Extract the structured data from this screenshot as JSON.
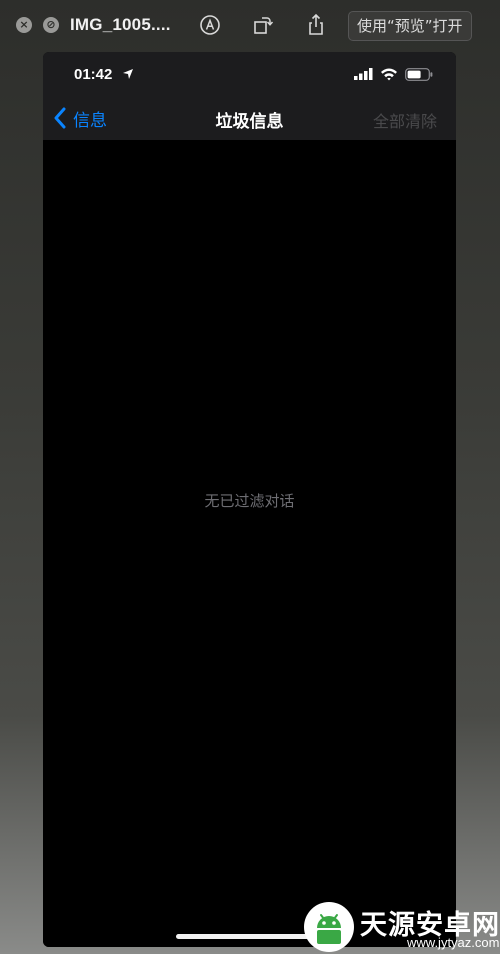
{
  "window": {
    "file_title": "IMG_1005....",
    "open_with_label": "使用“预览”打开"
  },
  "phone": {
    "status_bar": {
      "time": "01:42"
    },
    "nav": {
      "back_label": "信息",
      "title": "垃圾信息",
      "clear_all_label": "全部清除"
    },
    "empty_state": "无已过滤对话"
  },
  "watermark": {
    "name": "天源安卓网",
    "url": "www.jytyaz.com"
  },
  "colors": {
    "ios_blue": "#0a84ff",
    "disabled_gray": "#4a4a4c",
    "nav_bg": "#1c1c1e"
  }
}
